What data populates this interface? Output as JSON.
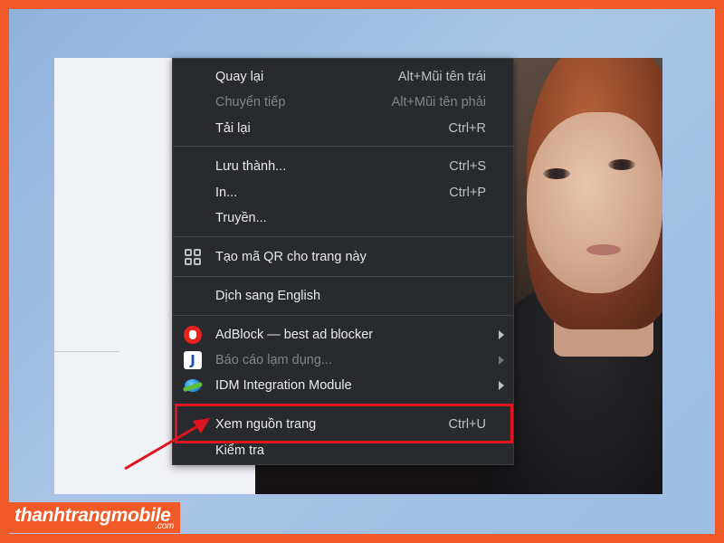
{
  "context_menu": {
    "items": [
      {
        "label": "Quay lại",
        "shortcut": "Alt+Mũi tên trái",
        "disabled": false
      },
      {
        "label": "Chuyển tiếp",
        "shortcut": "Alt+Mũi tên phải",
        "disabled": true
      },
      {
        "label": "Tải lại",
        "shortcut": "Ctrl+R",
        "disabled": false
      },
      {
        "label": "Lưu thành...",
        "shortcut": "Ctrl+S",
        "disabled": false
      },
      {
        "label": "In...",
        "shortcut": "Ctrl+P",
        "disabled": false
      },
      {
        "label": "Truyền...",
        "shortcut": "",
        "disabled": false
      },
      {
        "label": "Tạo mã QR cho trang này",
        "shortcut": "",
        "icon": "qr-code-icon",
        "disabled": false
      },
      {
        "label": "Dịch sang English",
        "shortcut": "",
        "disabled": false
      },
      {
        "label": "AdBlock — best ad blocker",
        "shortcut": "",
        "icon": "adblock-icon",
        "submenu": true,
        "disabled": false
      },
      {
        "label": "Báo cáo lạm dụng...",
        "shortcut": "",
        "icon": "report-abuse-icon",
        "submenu": true,
        "disabled": true
      },
      {
        "label": "IDM Integration Module",
        "shortcut": "",
        "icon": "idm-icon",
        "submenu": true,
        "disabled": false
      },
      {
        "label": "Xem nguồn trang",
        "shortcut": "Ctrl+U",
        "highlighted": true,
        "disabled": false
      },
      {
        "label": "Kiểm tra",
        "shortcut": "",
        "disabled": false
      }
    ]
  },
  "watermark": {
    "brand": "thanhtrangmobile",
    "suffix": ".com"
  },
  "colors": {
    "menu_bg": "#292a2d",
    "highlight": "#e0141e",
    "frame_border": "#f05a28"
  }
}
